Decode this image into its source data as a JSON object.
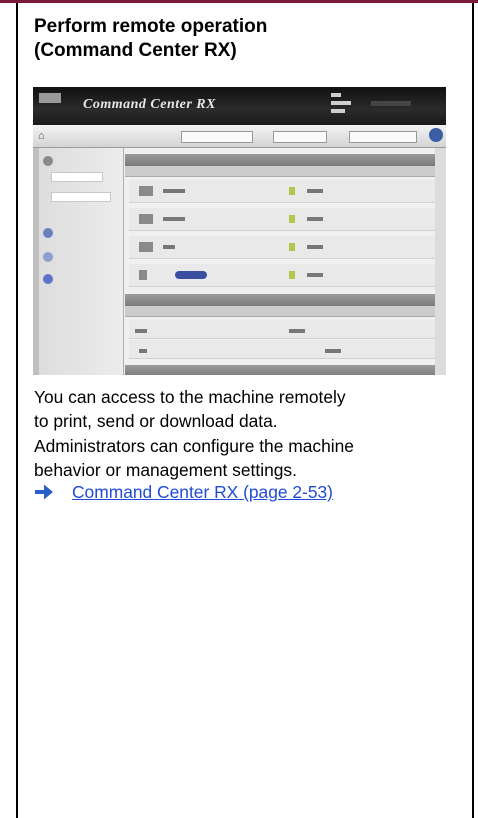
{
  "heading": {
    "line1": "Perform remote operation",
    "line2": "(Command Center RX)"
  },
  "screenshot": {
    "brand_text": "Command Center RX",
    "icons": [
      "home-icon",
      "help-icon"
    ]
  },
  "body": {
    "paragraph1_line1": "You can access to the machine remotely",
    "paragraph1_line2": "to print, send or download data.",
    "paragraph2_line1": "Administrators can configure the machine",
    "paragraph2_line2": "behavior or management settings."
  },
  "reference": {
    "link_text": "Command Center RX (page 2-53)",
    "arrow_icon": "right-arrow-icon"
  },
  "colors": {
    "top_rule": "#7b1a3a",
    "link": "#1f4bd6",
    "arrow": "#2a5fc8"
  }
}
